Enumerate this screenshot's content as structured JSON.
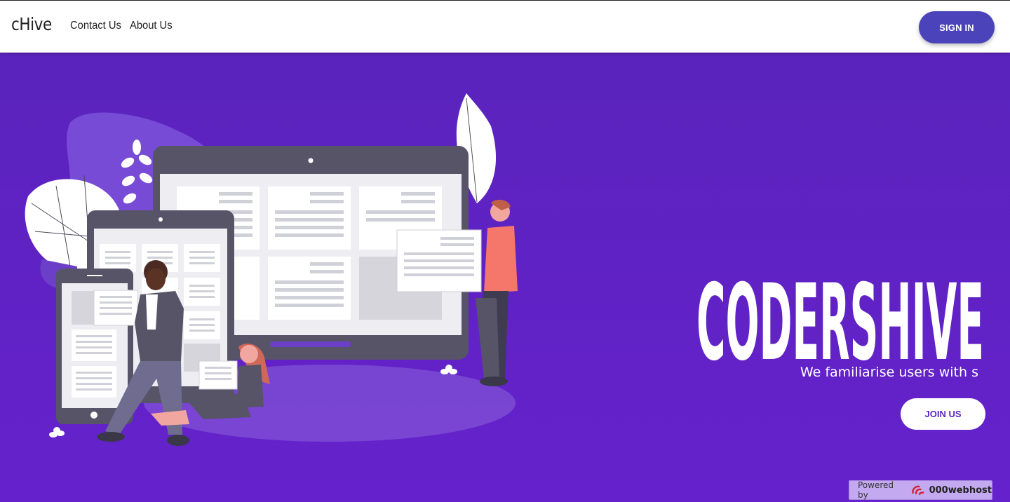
{
  "navbar": {
    "brand": "cHive",
    "links": [
      "Contact Us",
      "About Us"
    ],
    "signin_label": "SIGN IN"
  },
  "hero": {
    "title": "CODERSHIVE",
    "tagline": "We familiarise users with s",
    "join_label": "JOIN US",
    "illustration_icon": "devices-people-illustration"
  },
  "footer_badge": {
    "powered_by": "Powered by",
    "host": "000webhost",
    "logo_icon": "000webhost-logo-icon"
  },
  "colors": {
    "hero_bg": "#5a23bd",
    "signin_bg": "#4a43ba",
    "join_text": "#5a22c4"
  }
}
